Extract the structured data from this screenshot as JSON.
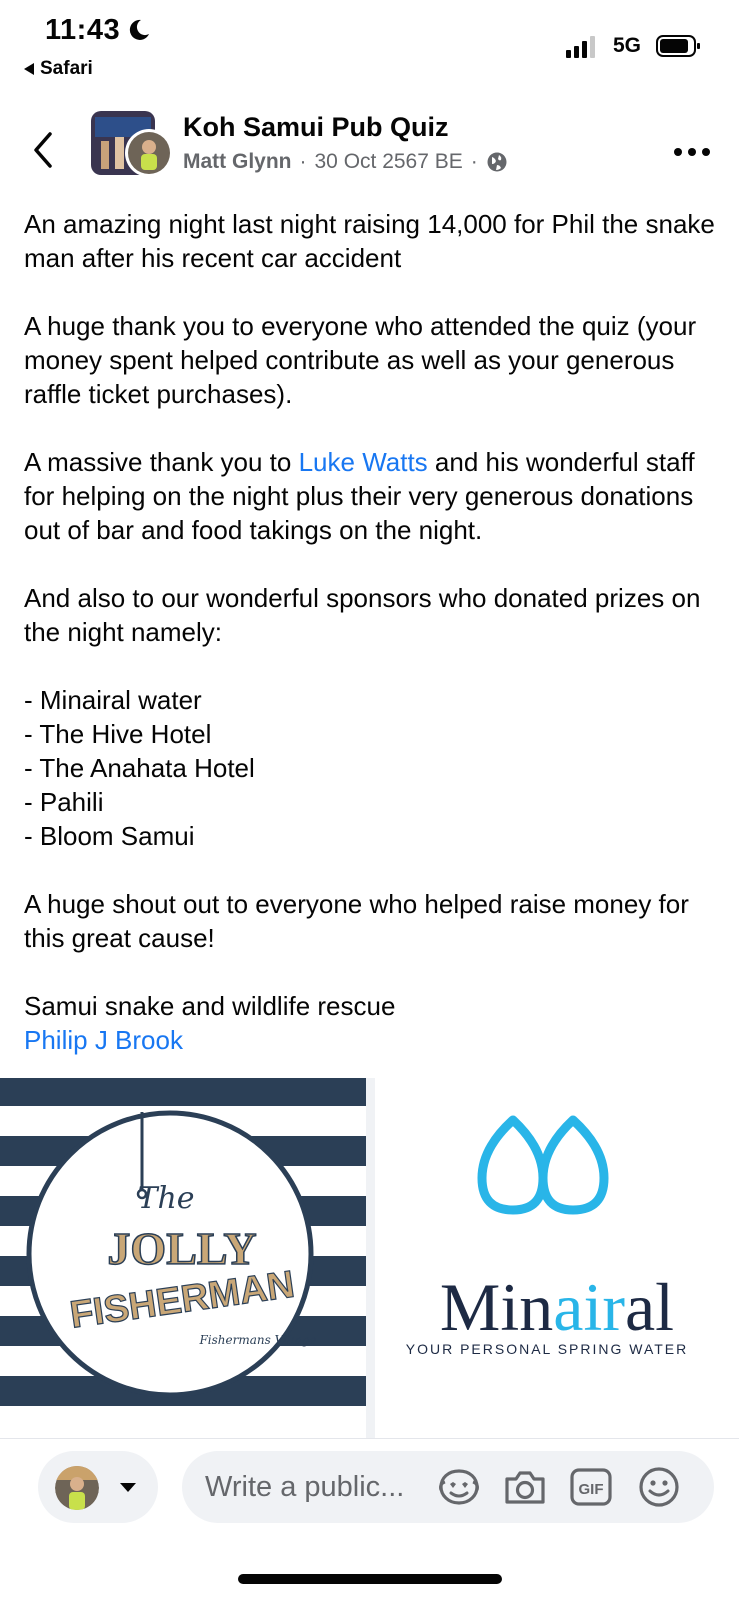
{
  "status_bar": {
    "time": "11:43",
    "back_app": "Safari",
    "network": "5G"
  },
  "header": {
    "page_name": "Koh Samui Pub Quiz",
    "author": "Matt Glynn",
    "separator": "·",
    "date": "30 Oct 2567 BE",
    "visibility_icon": "globe-icon"
  },
  "post": {
    "p1": "An amazing night last night raising 14,000 for Phil the snake man after his recent car accident",
    "p2": "A huge thank you to everyone who attended the quiz (your money spent helped contribute as well as your generous raffle ticket purchases).",
    "p3_before": "A massive thank you to ",
    "p3_link": "Luke Watts",
    "p3_after": " and his wonderful staff for helping on the night plus their very generous donations out of bar and food takings on the night.",
    "p4": "And also to our wonderful sponsors who donated prizes on the night namely:",
    "sponsors": [
      "- Minairal water",
      "- The Hive Hotel",
      "- The Anahata Hotel",
      "- Pahili",
      "- Bloom Samui"
    ],
    "p5": "A huge shout out to everyone who helped raise money for this great cause!",
    "p6": "Samui snake and wildlife rescue",
    "p6_link": "Philip J Brook"
  },
  "images": {
    "left": {
      "logo_the": "The",
      "logo_jolly": "JOLLY",
      "logo_fisherman": "FISHERMAN",
      "logo_sub": "Fishermans Village"
    },
    "right": {
      "brand_min": "Min",
      "brand_air": "air",
      "brand_al": "al",
      "tagline": "YOUR PERSONAL SPRING WATER"
    }
  },
  "comment_bar": {
    "placeholder": "Write a public...",
    "icons": [
      "avatar-sticker-icon",
      "camera-icon",
      "gif-icon",
      "emoji-icon"
    ]
  },
  "colors": {
    "link": "#1877f2",
    "secondary_text": "#65676b",
    "navy": "#2b3f56",
    "water_blue": "#29b5e8"
  }
}
